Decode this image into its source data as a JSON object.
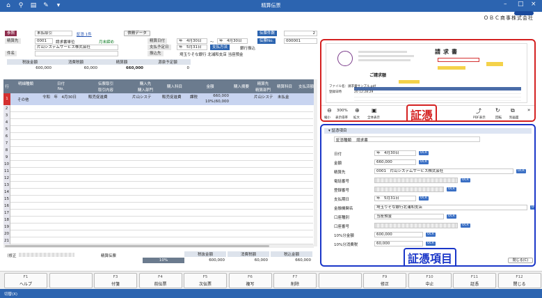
{
  "window": {
    "title": "精算伝票",
    "company": "ＯＢＣ商事株式会社"
  },
  "header": {
    "ref_label": "参照",
    "ref_value": "未払取引",
    "voucher_link": "証憑 1件",
    "debt_btn": "債務データ",
    "count_label": "伝票件数",
    "count_value": "2",
    "payee_label": "精算先",
    "payee_code": "0001",
    "payee_unit": "請求書単位",
    "month_close": "月末締め",
    "payee_name": "片山システムサービス株式会社",
    "settle_date_label": "精算日付",
    "settle_date_from": "年　4月30日",
    "tilde": "～",
    "settle_date_to": "年　4月30日",
    "voucher_no_label": "伝票No.",
    "voucher_no": "000001",
    "due_label": "支払予定日",
    "due_value": "年　5月31日",
    "pay_method_label": "支払方法",
    "pay_method": "銀行振込",
    "transfer_label": "振込先",
    "transfer_value": "埼玉りそな銀行 北浦和支店 当座預金",
    "subject_label": "件名"
  },
  "totals": {
    "headers": [
      "税抜金額",
      "消費税額",
      "精算額",
      "源泉予定額"
    ],
    "values": [
      "600,000",
      "60,000",
      "660,000",
      "0"
    ]
  },
  "grid": {
    "headers": [
      "行",
      "明細種類",
      "日付",
      "No.",
      "伝票取引",
      "取引内容",
      "購入先",
      "購入部門",
      "購入科目",
      "金額",
      "購入摘要",
      "精算先",
      "精算部門",
      "精算科目",
      "支払済額"
    ],
    "row1": {
      "num": "1",
      "type": "その他",
      "date": "令和　年　4月30日",
      "desc": "販売促進費",
      "dept": "片山システ",
      "subject": "販売促進費",
      "tax": "課税",
      "rate": "10%",
      "amount": "660,000",
      "tax_amount": "(60,000",
      "settle": "片山システ",
      "settle_subj": "未払金"
    },
    "row_numbers": [
      "1",
      "2",
      "3",
      "4",
      "5",
      "6",
      "7",
      "8",
      "9",
      "10",
      "11",
      "12",
      "13",
      "14",
      "15",
      "16",
      "17",
      "18",
      "19",
      "20",
      "21"
    ]
  },
  "footer": {
    "modify": "〔修正",
    "voucher_kind": "精算伝票",
    "sum_headers": [
      "税抜金額",
      "消費税額",
      "税込金額"
    ],
    "rate": "10%",
    "sum_values": [
      "600,000",
      "60,000",
      "660,000"
    ]
  },
  "voucher_panel": {
    "doc_title": "請求書",
    "to": "ご請求額",
    "zoom": "300%",
    "tools": [
      "縮小",
      "表示倍率",
      "拡大",
      "全体表示"
    ],
    "right_tools": [
      "PDF表示",
      "回転",
      "別画面"
    ],
    "file_name": "ファイル名：請求書サンプル.pdf",
    "reg_date": "登録日時　　　　20 12:28:29",
    "tag": "証憑"
  },
  "item_panel": {
    "section": "証憑項目",
    "kind_label": "証憑種類",
    "kind_value": "請求書",
    "rows": [
      {
        "label": "日付",
        "value": "年　4月30日"
      },
      {
        "label": "金額",
        "value": "660,000"
      },
      {
        "label": "精算先",
        "value": "0001　片山システムサービス株式会社"
      },
      {
        "label": "電話番号",
        "value": ""
      },
      {
        "label": "登録番号",
        "value": ""
      },
      {
        "label": "支払期日",
        "value": "年　5月31日"
      },
      {
        "label": "金融機関名",
        "value": "埼玉りそな銀行北浦和支店"
      },
      {
        "label": "口座種別",
        "value": "当座預金"
      },
      {
        "label": "口座番号",
        "value": ""
      },
      {
        "label": "10%分金額",
        "value": "600,000"
      },
      {
        "label": "10%分消費税",
        "value": "60,000"
      }
    ],
    "ocr": "OCR",
    "required": "必須",
    "verified": "登録済",
    "tax_ex": "税抜",
    "tax_label": "税額",
    "close": "閉じる(C)",
    "tag": "証憑項目"
  },
  "fkeys": [
    {
      "n": "F1",
      "l": "ヘルプ"
    },
    {
      "n": "",
      "l": ""
    },
    {
      "n": "F3",
      "l": "付箋"
    },
    {
      "n": "F4",
      "l": "前伝票"
    },
    {
      "n": "F5",
      "l": "次伝票"
    },
    {
      "n": "F6",
      "l": "複写"
    },
    {
      "n": "F7",
      "l": "削除"
    },
    {
      "n": "",
      "l": ""
    },
    {
      "n": "F9",
      "l": "修正"
    },
    {
      "n": "F10",
      "l": "中止"
    },
    {
      "n": "F11",
      "l": "証憑"
    },
    {
      "n": "F12",
      "l": "閉じる"
    }
  ],
  "status": {
    "text": "切替(X)"
  }
}
